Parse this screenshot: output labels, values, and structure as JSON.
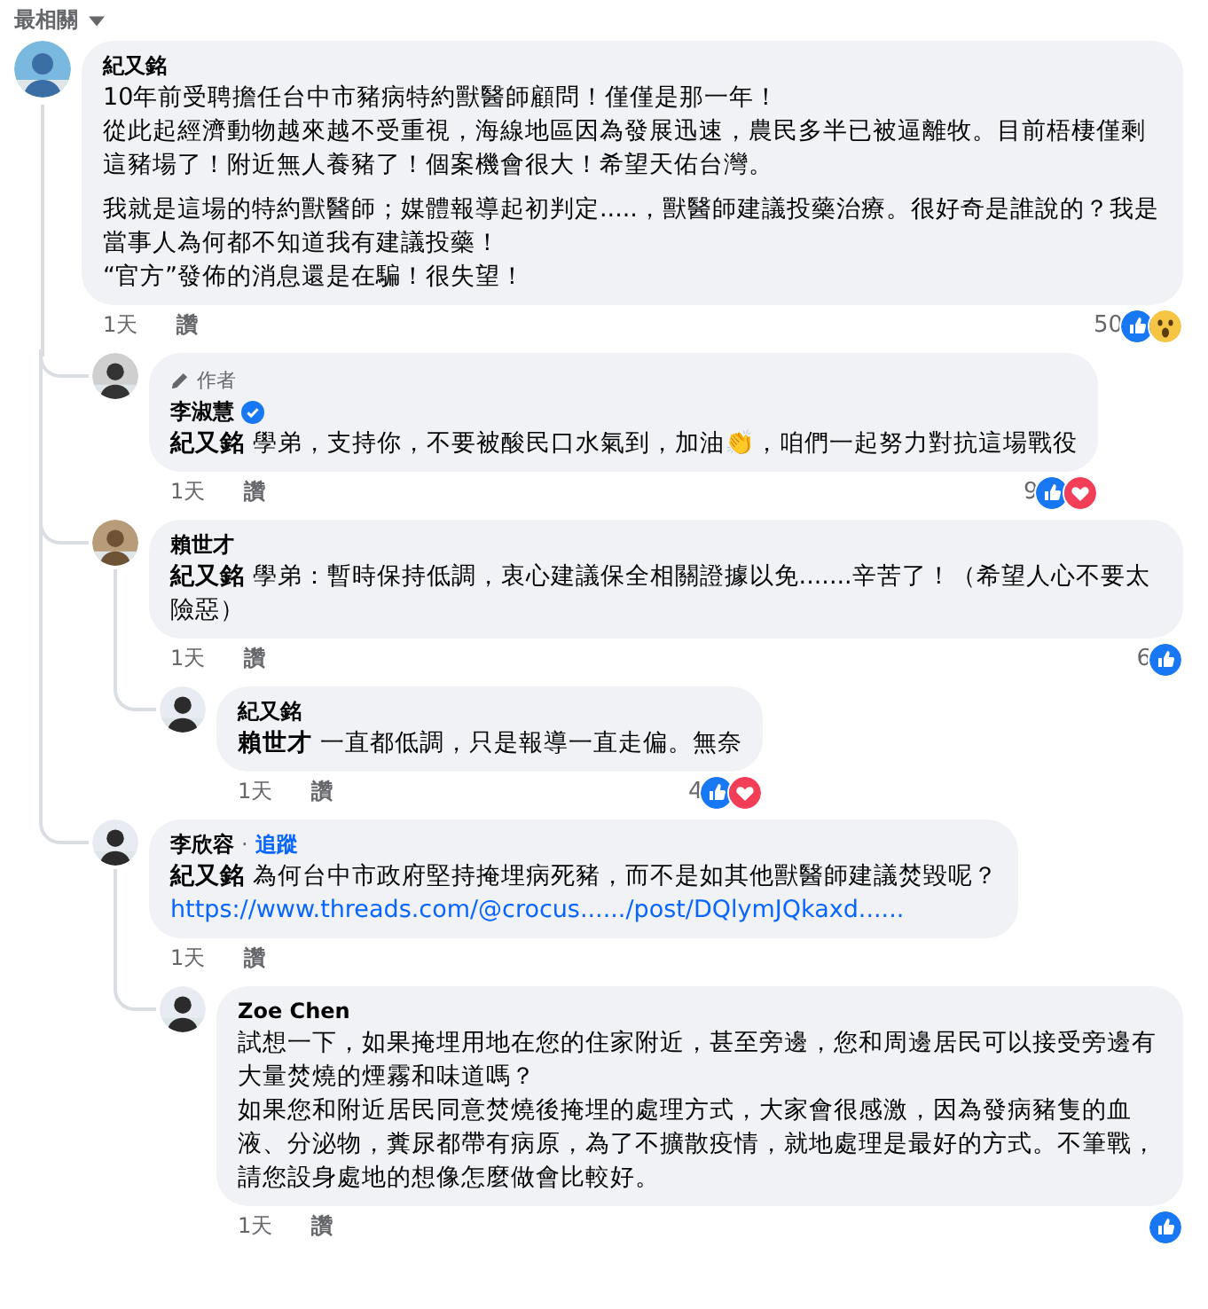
{
  "sort": {
    "label": "最相關"
  },
  "comments": [
    {
      "name": "紀又銘",
      "paragraphs": [
        [
          "10年前受聘擔任台中市豬病特約獸醫師顧問！僅僅是那一年！",
          "從此起經濟動物越來越不受重視，海線地區因為發展迅速，農民多半已被逼離牧。目前梧棲僅剩這豬場了！附近無人養豬了！個案機會很大！希望天佑台灣。"
        ],
        [
          "我就是這場的特約獸醫師；媒體報導起初判定.....，獸醫師建議投藥治療。很好奇是誰說的？我是當事人為何都不知道我有建議投藥！",
          "“官方”發佈的消息還是在騙！很失望！"
        ]
      ],
      "time": "1天",
      "like_label": "讚",
      "reaction_count": "50",
      "reactions": [
        {
          "kind": "like"
        },
        {
          "kind": "wow"
        }
      ],
      "children": [
        {
          "badge": "作者",
          "name": "李淑慧",
          "verified": true,
          "paragraphs": [
            [
              "**紀又銘** 學弟，支持你，不要被酸民口水氣到，加油👏，咱們一起努力對抗這場戰役"
            ]
          ],
          "time": "1天",
          "like_label": "讚",
          "reaction_count": "9",
          "reactions": [
            {
              "kind": "like"
            },
            {
              "kind": "love"
            }
          ]
        },
        {
          "name": "賴世才",
          "paragraphs": [
            [
              "**紀又銘** 學弟：暫時保持低調，衷心建議保全相關證據以免.......辛苦了！（希望人心不要太險惡）"
            ]
          ],
          "time": "1天",
          "like_label": "讚",
          "reaction_count": "6",
          "reactions": [
            {
              "kind": "like"
            }
          ],
          "children": [
            {
              "name": "紀又銘",
              "paragraphs": [
                [
                  "**賴世才** 一直都低調，只是報導一直走偏。無奈"
                ]
              ],
              "time": "1天",
              "like_label": "讚",
              "reaction_count": "4",
              "reactions": [
                {
                  "kind": "like"
                },
                {
                  "kind": "love"
                }
              ]
            }
          ]
        },
        {
          "name": "李欣容",
          "follow_separator": "·",
          "follow": "追蹤",
          "paragraphs": [
            [
              "**紀又銘** 為何台中市政府堅持掩埋病死豬，而不是如其他獸醫師建議焚毀呢？"
            ]
          ],
          "link": "https://www.threads.com/@crocus....../post/DQlymJQkaxd......",
          "time": "1天",
          "like_label": "讚",
          "children": [
            {
              "name": "Zoe Chen",
              "paragraphs": [
                [
                  "試想一下，如果掩埋用地在您的住家附近，甚至旁邊，您和周邊居民可以接受旁邊有大量焚燒的煙霧和味道嗎？",
                  "如果您和附近居民同意焚燒後掩埋的處理方式，大家會很感激，因為發病豬隻的血液、分泌物，糞尿都帶有病原，為了不擴散疫情，就地處理是最好的方式。不筆戰，請您設身處地的想像怎麼做會比較好。"
                ]
              ],
              "time": "1天",
              "like_label": "讚",
              "reactions": [
                {
                  "kind": "like"
                }
              ]
            }
          ]
        }
      ]
    }
  ]
}
